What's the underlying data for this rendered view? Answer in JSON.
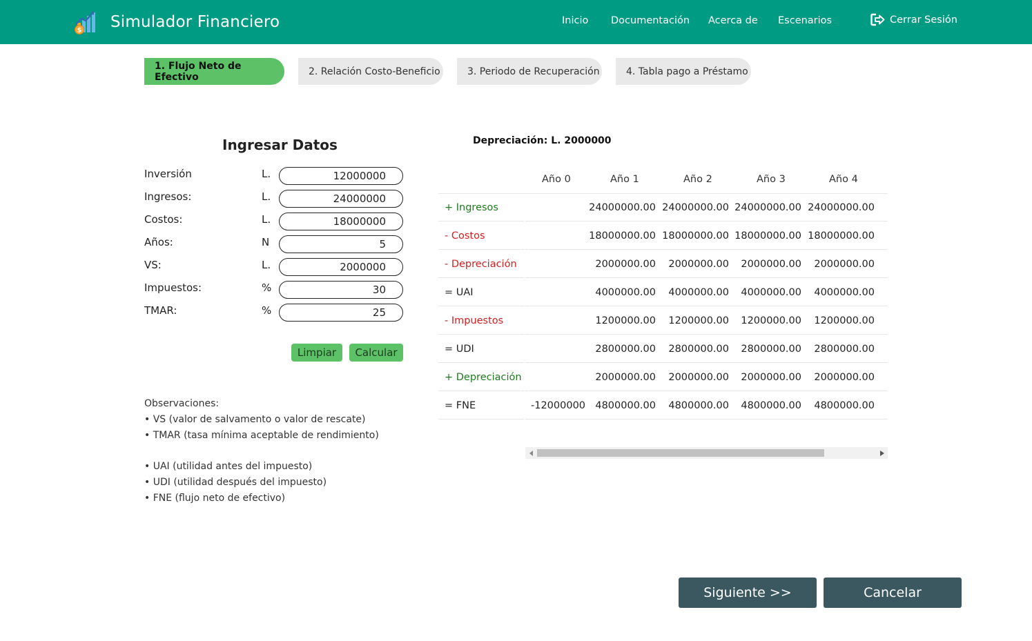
{
  "navbar": {
    "title": "Simulador Financiero",
    "links": [
      "Inicio",
      "Documentación",
      "Acerca de",
      "Escenarios"
    ],
    "logout": "Cerrar Sesión"
  },
  "tabs": [
    "1. Flujo Neto de Efectivo",
    "2. Relación Costo-Beneficio",
    "3. Periodo de Recuperación",
    "4. Tabla pago a Préstamo"
  ],
  "form": {
    "title": "Ingresar Datos",
    "fields": [
      {
        "label": "Inversión",
        "symbol": "L.",
        "value": "12000000"
      },
      {
        "label": "Ingresos:",
        "symbol": "L.",
        "value": "24000000"
      },
      {
        "label": "Costos:",
        "symbol": "L.",
        "value": "18000000"
      },
      {
        "label": "Años:",
        "symbol": "N",
        "value": "5"
      },
      {
        "label": "VS:",
        "symbol": "L.",
        "value": "2000000"
      },
      {
        "label": "Impuestos:",
        "symbol": "%",
        "value": "30"
      },
      {
        "label": "TMAR:",
        "symbol": "%",
        "value": "25"
      }
    ],
    "clear_label": "Limpiar",
    "calc_label": "Calcular"
  },
  "notes": {
    "heading": "Observaciones:",
    "items": [
      "• VS (valor de salvamento o valor de rescate)",
      "• TMAR (tasa mínima aceptable de rendimiento)",
      "",
      "• UAI (utilidad antes del impuesto)",
      "• UDI (utilidad después del impuesto)",
      "• FNE (flujo neto de efectivo)"
    ]
  },
  "results": {
    "depreciation_label": "Depreciación: L. 2000000",
    "headers": [
      "Año 0",
      "Año 1",
      "Año 2",
      "Año 3",
      "Año 4"
    ],
    "rows": [
      {
        "label": "+ Ingresos",
        "color": "#1e7a1e",
        "year0": "",
        "values": [
          "24000000.00",
          "24000000.00",
          "24000000.00",
          "24000000.00"
        ]
      },
      {
        "label": "- Costos",
        "color": "#d11f1f",
        "year0": "",
        "values": [
          "18000000.00",
          "18000000.00",
          "18000000.00",
          "18000000.00"
        ]
      },
      {
        "label": "- Depreciación",
        "color": "#d11f1f",
        "year0": "",
        "values": [
          "2000000.00",
          "2000000.00",
          "2000000.00",
          "2000000.00"
        ]
      },
      {
        "label": "= UAI",
        "color": "#222222",
        "year0": "",
        "values": [
          "4000000.00",
          "4000000.00",
          "4000000.00",
          "4000000.00"
        ]
      },
      {
        "label": "- Impuestos",
        "color": "#d11f1f",
        "year0": "",
        "values": [
          "1200000.00",
          "1200000.00",
          "1200000.00",
          "1200000.00"
        ]
      },
      {
        "label": "= UDI",
        "color": "#222222",
        "year0": "",
        "values": [
          "2800000.00",
          "2800000.00",
          "2800000.00",
          "2800000.00"
        ]
      },
      {
        "label": "+ Depreciación",
        "color": "#1e7a1e",
        "year0": "",
        "values": [
          "2000000.00",
          "2000000.00",
          "2000000.00",
          "2000000.00"
        ]
      },
      {
        "label": "= FNE",
        "color": "#222222",
        "year0": "-12000000",
        "values": [
          "4800000.00",
          "4800000.00",
          "4800000.00",
          "4800000.00"
        ]
      }
    ]
  },
  "actions": {
    "next_label": "Siguiente >>",
    "cancel_label": "Cancelar"
  },
  "colors": {
    "navbar": "#009b83",
    "active_tab": "#5cc167",
    "inactive_tab": "#e9e9e9",
    "action_button": "#3b5861"
  }
}
